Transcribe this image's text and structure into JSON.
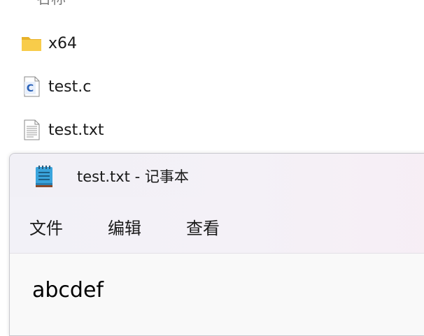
{
  "explorer": {
    "column_header": "名称",
    "files": [
      {
        "name": "x64",
        "icon": "folder-icon"
      },
      {
        "name": "test.c",
        "icon": "c-source-file-icon"
      },
      {
        "name": "test.txt",
        "icon": "text-file-icon"
      }
    ]
  },
  "notepad": {
    "title": "test.txt - 记事本",
    "icon": "notepad-icon",
    "menu": [
      "文件",
      "编辑",
      "查看"
    ],
    "content": "abcdef"
  },
  "colors": {
    "folder_yellow": "#f6c83d",
    "c_badge_blue": "#2a62b8",
    "notepad_blue": "#3aa4dc",
    "titlebar_bg": "#f4f1f7",
    "editor_bg": "#f9f9f9"
  }
}
